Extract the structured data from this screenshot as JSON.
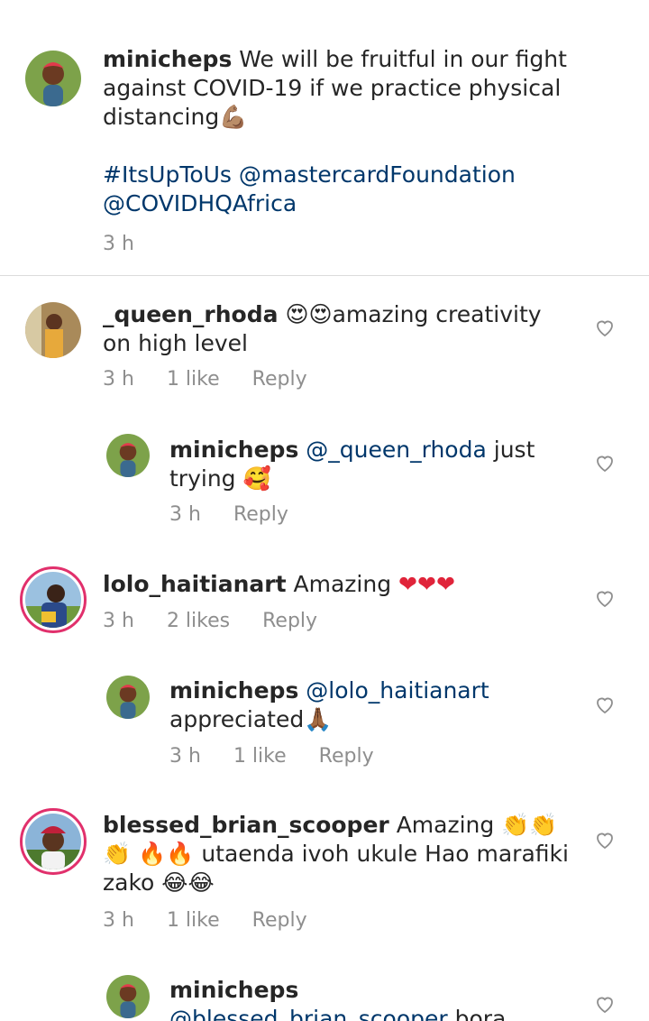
{
  "caption": {
    "username": "minicheps",
    "text_line": "We will be fruitful in our fight against COVID-19 if we practice physical distancing",
    "emoji": "💪🏽",
    "hashtag": "#ItsUpToUs",
    "mention1": "@mastercardFoundation",
    "mention2": "@COVIDHQAfrica",
    "time": "3 h"
  },
  "comments": [
    {
      "username": "_queen_rhoda",
      "emoji_prefix": "😍😍",
      "text": "amazing creativity on high level",
      "time": "3 h",
      "likes": "1 like",
      "reply": "Reply"
    },
    {
      "username": "minicheps",
      "mention": "@_queen_rhoda",
      "text": "just trying",
      "emoji": "🥰",
      "time": "3 h",
      "reply": "Reply"
    },
    {
      "username": "lolo_haitianart",
      "text": "Amazing",
      "emoji": "❤❤❤",
      "time": "3 h",
      "likes": "2 likes",
      "reply": "Reply"
    },
    {
      "username": "minicheps",
      "mention": "@lolo_haitianart",
      "text": "appreciated",
      "emoji": "🙏🏾",
      "time": "3 h",
      "likes": "1 like",
      "reply": "Reply"
    },
    {
      "username": "blessed_brian_scooper",
      "text": "Amazing",
      "emoji1": "👏👏👏",
      "emoji2": "🔥🔥",
      "text2": "utaenda ivoh ukule Hao marafiki zako",
      "emoji3": "😂😂",
      "time": "3 h",
      "likes": "1 like",
      "reply": "Reply"
    },
    {
      "username": "minicheps",
      "mention": "@blessed_brian_scooper",
      "text": "bora isipite lunchtime kama bado"
    }
  ],
  "colors": {
    "link": "#00376b",
    "meta": "#8e8e8e",
    "divider": "#dbdbdb",
    "story_ring": "#e1306c"
  },
  "icons": {
    "like": "heart-outline-icon"
  }
}
